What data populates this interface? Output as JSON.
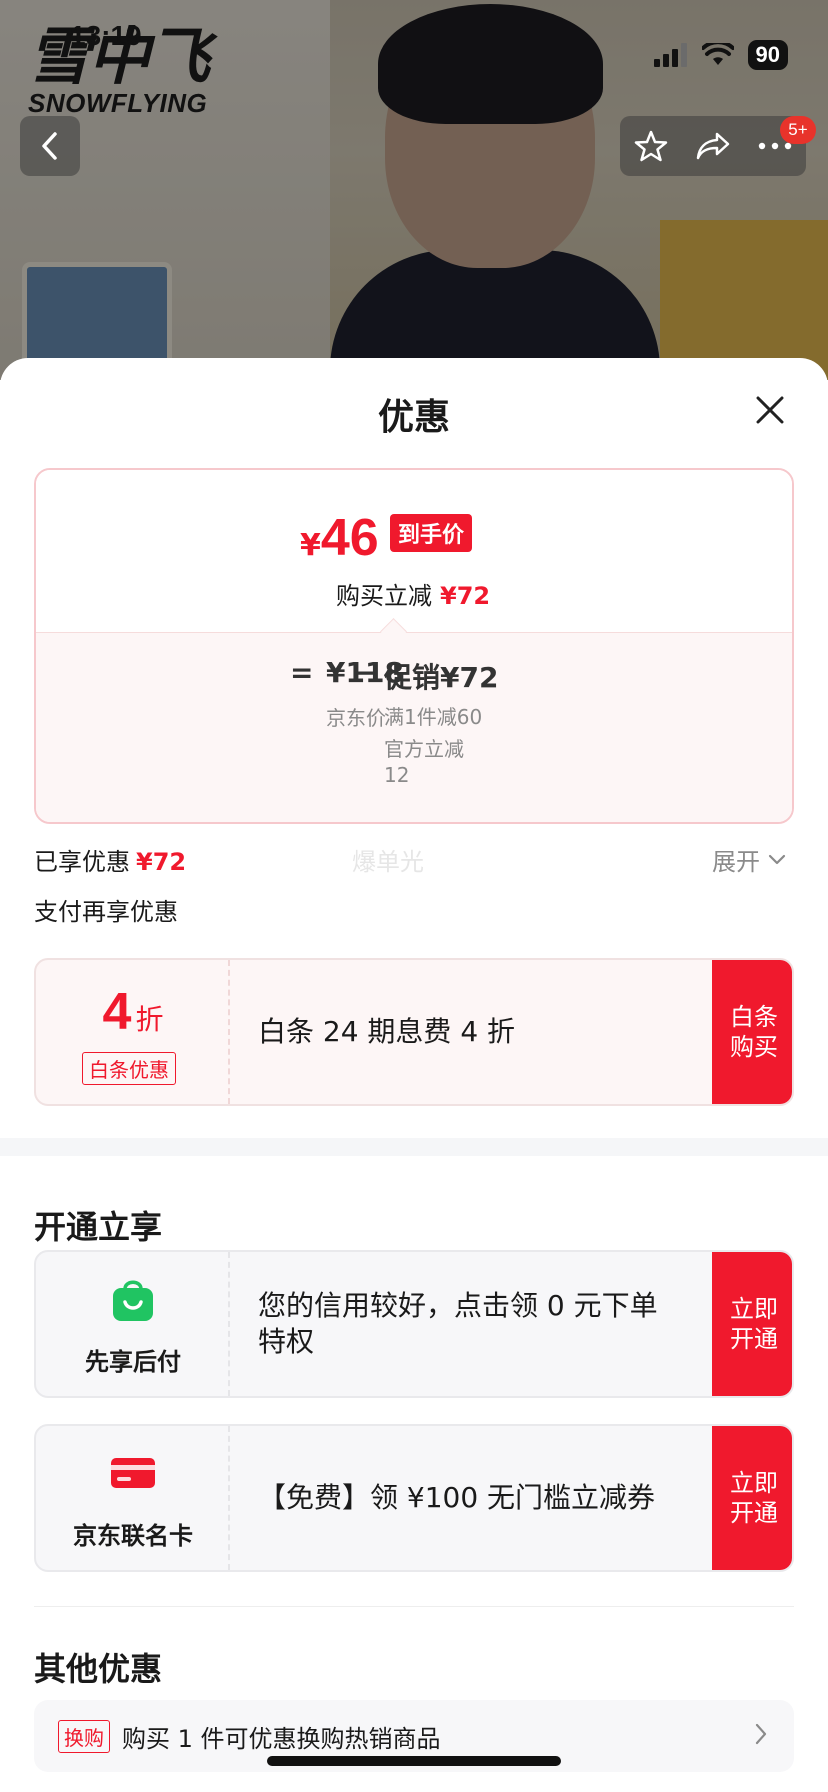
{
  "status_bar": {
    "time": "13:19",
    "battery": "90"
  },
  "brand": {
    "logo_cn": "雪中飞",
    "logo_en": "SNOWFLYING"
  },
  "nav": {
    "badge": "5+"
  },
  "sheet": {
    "title": "优惠",
    "final_price": {
      "symbol": "¥",
      "value": "46",
      "tag": "到手价"
    },
    "instant_reduce": {
      "label": "购买立减",
      "amount": "¥72"
    },
    "calculation": {
      "equals": "=",
      "base_value": "¥118",
      "base_label": "京东价",
      "minus": "−",
      "promo_value": "促销¥72",
      "promo_details": [
        "满1件减60",
        "官方立减",
        "12"
      ]
    },
    "enjoyed": {
      "label": "已享优惠",
      "amount": "¥72"
    },
    "watermark": "爆单光",
    "expand_label": "展开",
    "pay_more_title": "支付再享优惠",
    "baitiao": {
      "discount_num": "4",
      "discount_unit": "折",
      "tag": "白条优惠",
      "text": "白条 24 期息费 4 折",
      "button": "白条购买"
    },
    "open_title": "开通立享",
    "open_items": [
      {
        "label": "先享后付",
        "text": "您的信用较好，点击领 0 元下单特权",
        "button": "立即开通",
        "icon": "green-bag-icon"
      },
      {
        "label": "京东联名卡",
        "text": "【免费】领 ¥100 无门槛立减券",
        "button": "立即开通",
        "icon": "red-card-icon"
      }
    ],
    "other_title": "其他优惠",
    "other_item": {
      "tag": "换购",
      "text": "购买 1 件可优惠换购热销商品"
    }
  },
  "colors": {
    "accent": "#f0192d",
    "green": "#20c462"
  }
}
